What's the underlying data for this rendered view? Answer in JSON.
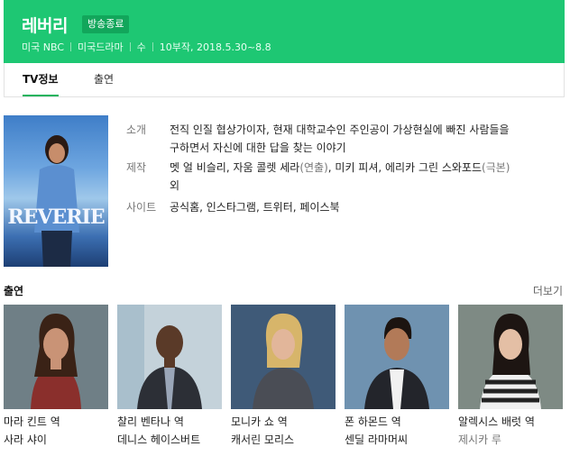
{
  "header": {
    "title": "레버리",
    "badge": "방송종료",
    "meta": [
      "미국 NBC",
      "미국드라마",
      "수",
      "10부작, 2018.5.30~8.8"
    ]
  },
  "tabs": [
    {
      "label": "TV정보",
      "active": true
    },
    {
      "label": "출연",
      "active": false
    }
  ],
  "poster": {
    "text": "REVERIE"
  },
  "info": {
    "summary_label": "소개",
    "summary_line1": "전직 인질 협상가이자, 현재 대학교수인 주인공이 가상현실에 빠진 사람들을",
    "summary_line2": "구하면서 자신에 대한 답을 찾는 이야기",
    "production_label": "제작",
    "production_part1": "멧 얼 비슬리, 자움 콜렛 세라",
    "production_paren1": "(연출)",
    "production_part2": ", 미키 피셔, 에리카 그린 스와포드",
    "production_paren2": "(극본)",
    "production_line2": "외",
    "site_label": "사이트",
    "sites": [
      "공식홈",
      "인스타그램",
      "트위터",
      "페이스북"
    ]
  },
  "cast_section": {
    "title": "출연",
    "more": "더보기"
  },
  "cast": [
    {
      "role": "마라 킨트 역",
      "actor": "사라 샤이",
      "dim": false
    },
    {
      "role": "찰리 벤타나 역",
      "actor": "데니스 헤이스버트",
      "dim": false
    },
    {
      "role": "모니카 쇼 역",
      "actor": "캐서린 모리스",
      "dim": false
    },
    {
      "role": "폰 하몬드 역",
      "actor": "센딜 라마머씨",
      "dim": false
    },
    {
      "role": "알렉시스 배럿 역",
      "actor": "제시카 루",
      "dim": true
    }
  ],
  "colors": {
    "header_bg": "#1ec773",
    "badge_bg": "#12a65b",
    "tab_underline": "#19b35d"
  }
}
